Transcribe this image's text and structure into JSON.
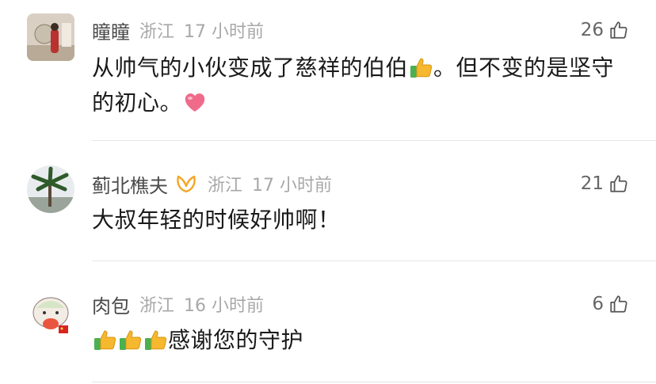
{
  "comments": [
    {
      "username": "瞳瞳",
      "location": "浙江",
      "time": "17 小时前",
      "likes": "26",
      "text_a": "从帅气的小伙变成了慈祥的伯伯",
      "text_b": "。但不变的是坚守的初心。",
      "emoji_a": "thumbs-up",
      "emoji_b": "heart"
    },
    {
      "username": "蓟北樵夫",
      "location": "浙江",
      "time": "17 小时前",
      "likes": "21",
      "text": "大叔年轻的时候好帅啊！",
      "badge": "vip-badge"
    },
    {
      "username": "肉包",
      "location": "浙江",
      "time": "16 小时前",
      "likes": "6",
      "text": "感谢您的守护",
      "emoji": "thumbs-up"
    }
  ],
  "colors": {
    "username": "#4a4a4a",
    "meta": "#a8a8a8",
    "badge": "#f5a623",
    "heart": "#f06b8a",
    "divider": "#e6e6e6"
  }
}
